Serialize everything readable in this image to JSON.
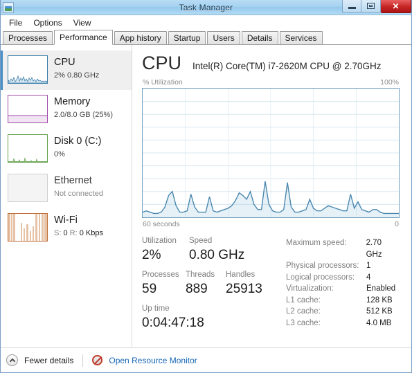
{
  "window": {
    "title": "Task Manager",
    "icon": "task-manager-icon",
    "buttons": {
      "minimize": "minimize-icon",
      "restore": "restore-icon",
      "close": "✕"
    }
  },
  "menubar": {
    "items": [
      {
        "label": "File"
      },
      {
        "label": "Options"
      },
      {
        "label": "View"
      }
    ]
  },
  "tabs": {
    "active": "Performance",
    "items": [
      {
        "label": "Processes"
      },
      {
        "label": "Performance"
      },
      {
        "label": "App history"
      },
      {
        "label": "Startup"
      },
      {
        "label": "Users"
      },
      {
        "label": "Details"
      },
      {
        "label": "Services"
      }
    ]
  },
  "sidebar": {
    "items": [
      {
        "name": "cpu",
        "title": "CPU",
        "sub": "2%  0.80 GHz",
        "selected": true,
        "color": "#3a7ca8",
        "fill": "rgba(120,175,210,0.30)",
        "graph": "spiky-low"
      },
      {
        "name": "memory",
        "title": "Memory",
        "sub": "2.0/8.0 GB (25%)",
        "selected": false,
        "color": "#a04aa8",
        "fill": "rgba(170,90,180,0.16)",
        "graph": "level-25"
      },
      {
        "name": "disk-0-c",
        "title": "Disk 0 (C:)",
        "sub": "0%",
        "selected": false,
        "color": "#63a04a",
        "fill": "rgba(120,180,95,0.35)",
        "graph": "spiky-flat"
      },
      {
        "name": "ethernet",
        "title": "Ethernet",
        "sub": "Not connected",
        "selected": false,
        "disabled": true,
        "color": "#c9c9c9",
        "fill": "rgba(0,0,0,0)",
        "graph": "empty"
      },
      {
        "name": "wifi",
        "title": "Wi-Fi",
        "sub_parts": [
          {
            "k": "S: ",
            "v": "0"
          },
          {
            "k": " R: ",
            "v": "0 Kbps"
          }
        ],
        "selected": false,
        "color": "#c0713a",
        "fill": "rgba(200,120,60,0.35)",
        "graph": "bars"
      }
    ]
  },
  "main": {
    "title": "CPU",
    "subtitle": "Intel(R) Core(TM) i7-2620M CPU @ 2.70GHz",
    "axis_y_label": "% Utilization",
    "axis_y_max": "100%",
    "axis_x_left": "60 seconds",
    "axis_x_right": "0",
    "graph_color": "#4a88b0",
    "graph_fill": "rgba(140,190,220,0.22)",
    "grid_color": "#d7e7f0",
    "stats": {
      "row1": [
        {
          "label": "Utilization",
          "value": "2%"
        },
        {
          "label": "Speed",
          "value": "0.80 GHz"
        }
      ],
      "row2": [
        {
          "label": "Processes",
          "value": "59"
        },
        {
          "label": "Threads",
          "value": "889"
        },
        {
          "label": "Handles",
          "value": "25913"
        }
      ],
      "uptime": {
        "label": "Up time",
        "value": "0:04:47:18"
      }
    },
    "specs": [
      {
        "key": "Maximum speed:",
        "value": "2.70 GHz"
      },
      {
        "key": "Physical processors:",
        "value": "1"
      },
      {
        "key": "Logical processors:",
        "value": "4"
      },
      {
        "key": "Virtualization:",
        "value": "Enabled"
      },
      {
        "key": "L1 cache:",
        "value": "128 KB"
      },
      {
        "key": "L2 cache:",
        "value": "512 KB"
      },
      {
        "key": "L3 cache:",
        "value": "4.0 MB"
      }
    ]
  },
  "footer": {
    "fewer_details": "Fewer details",
    "fewer_details_icon": "chevron-up-circle-icon",
    "resource_monitor_icon": "resource-monitor-icon",
    "resource_monitor": "Open Resource Monitor"
  },
  "chart_data": {
    "type": "line",
    "title": "CPU % Utilization over 60 seconds",
    "xlabel": "60 seconds",
    "ylabel": "% Utilization",
    "ylim": [
      0,
      100
    ],
    "grid": true,
    "grid_cols": 6,
    "grid_rows": 10,
    "series": [
      {
        "name": "CPU utilization",
        "values": [
          4,
          5,
          4,
          3,
          3,
          4,
          8,
          17,
          20,
          9,
          4,
          4,
          5,
          18,
          8,
          4,
          4,
          4,
          16,
          5,
          4,
          5,
          6,
          7,
          9,
          13,
          19,
          17,
          14,
          20,
          10,
          6,
          6,
          28,
          10,
          5,
          4,
          4,
          6,
          27,
          8,
          4,
          4,
          5,
          6,
          14,
          7,
          5,
          5,
          7,
          9,
          8,
          7,
          6,
          5,
          5,
          18,
          7,
          12,
          6,
          5,
          4,
          6,
          6,
          4,
          3,
          3,
          3,
          3,
          3
        ]
      }
    ]
  }
}
